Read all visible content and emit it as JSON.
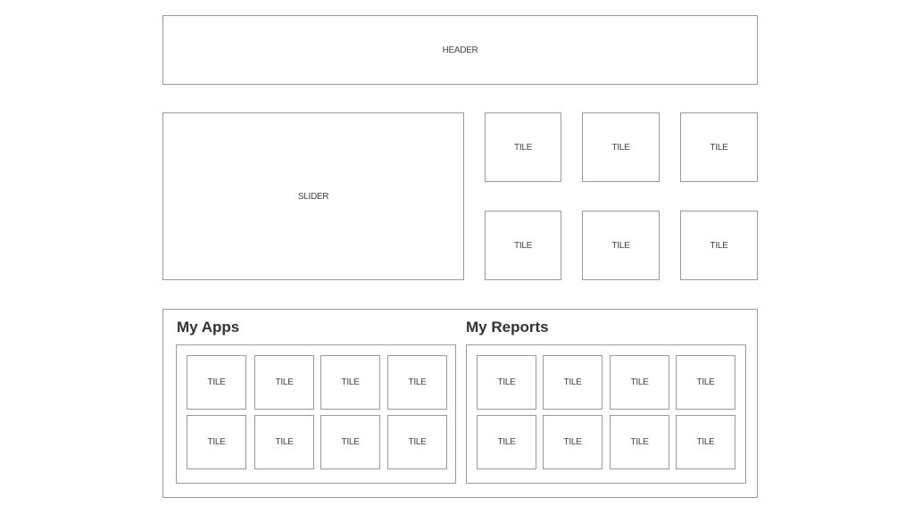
{
  "header": {
    "label": "HEADER"
  },
  "slider": {
    "label": "SLIDER"
  },
  "top_tiles": [
    "TILE",
    "TILE",
    "TILE",
    "TILE",
    "TILE",
    "TILE"
  ],
  "my_apps": {
    "title": "My Apps",
    "tiles": [
      "TILE",
      "TILE",
      "TILE",
      "TILE",
      "TILE",
      "TILE",
      "TILE",
      "TILE"
    ]
  },
  "my_reports": {
    "title": "My Reports",
    "tiles": [
      "TILE",
      "TILE",
      "TILE",
      "TILE",
      "TILE",
      "TILE",
      "TILE",
      "TILE"
    ]
  }
}
